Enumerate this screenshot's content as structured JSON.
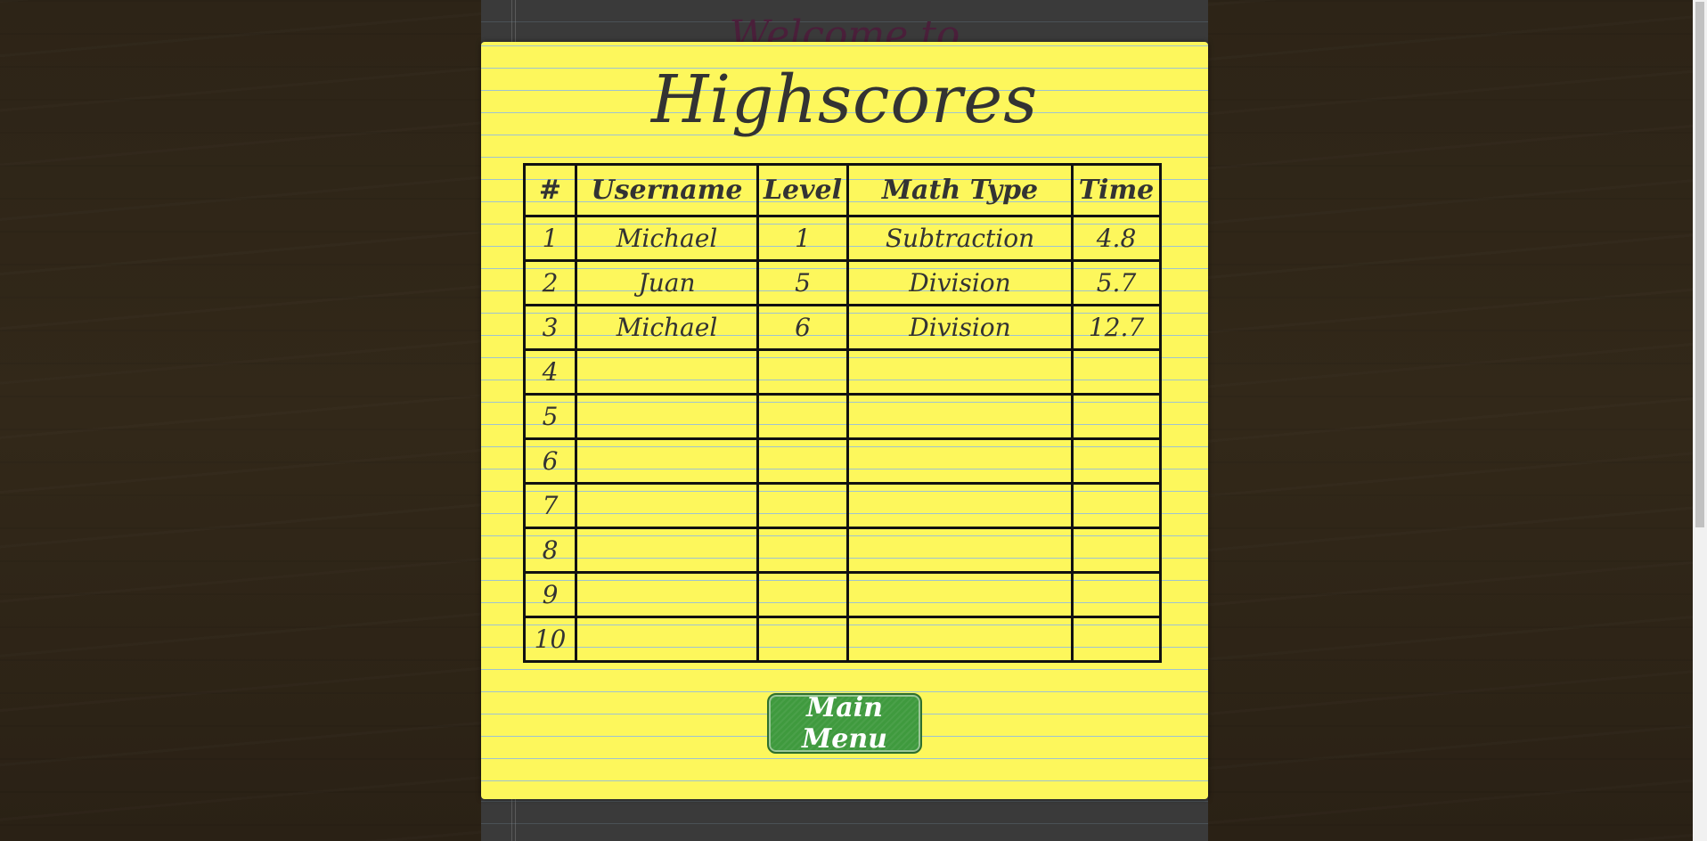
{
  "background_page": {
    "title": "Welcome to"
  },
  "modal": {
    "title": "Highscores",
    "table": {
      "headers": [
        "#",
        "Username",
        "Level",
        "Math Type",
        "Time"
      ],
      "rows": [
        {
          "rank": "1",
          "username": "Michael",
          "level": "1",
          "math_type": "Subtraction",
          "time": "4.8"
        },
        {
          "rank": "2",
          "username": "Juan",
          "level": "5",
          "math_type": "Division",
          "time": "5.7"
        },
        {
          "rank": "3",
          "username": "Michael",
          "level": "6",
          "math_type": "Division",
          "time": "12.7"
        },
        {
          "rank": "4",
          "username": "",
          "level": "",
          "math_type": "",
          "time": ""
        },
        {
          "rank": "5",
          "username": "",
          "level": "",
          "math_type": "",
          "time": ""
        },
        {
          "rank": "6",
          "username": "",
          "level": "",
          "math_type": "",
          "time": ""
        },
        {
          "rank": "7",
          "username": "",
          "level": "",
          "math_type": "",
          "time": ""
        },
        {
          "rank": "8",
          "username": "",
          "level": "",
          "math_type": "",
          "time": ""
        },
        {
          "rank": "9",
          "username": "",
          "level": "",
          "math_type": "",
          "time": ""
        },
        {
          "rank": "10",
          "username": "",
          "level": "",
          "math_type": "",
          "time": ""
        }
      ]
    },
    "main_menu_label": "Main Menu"
  },
  "colors": {
    "paper": "#fdf75c",
    "rule_line": "#9fc3d0",
    "button": "#3f9a3e",
    "ink": "#333333"
  }
}
